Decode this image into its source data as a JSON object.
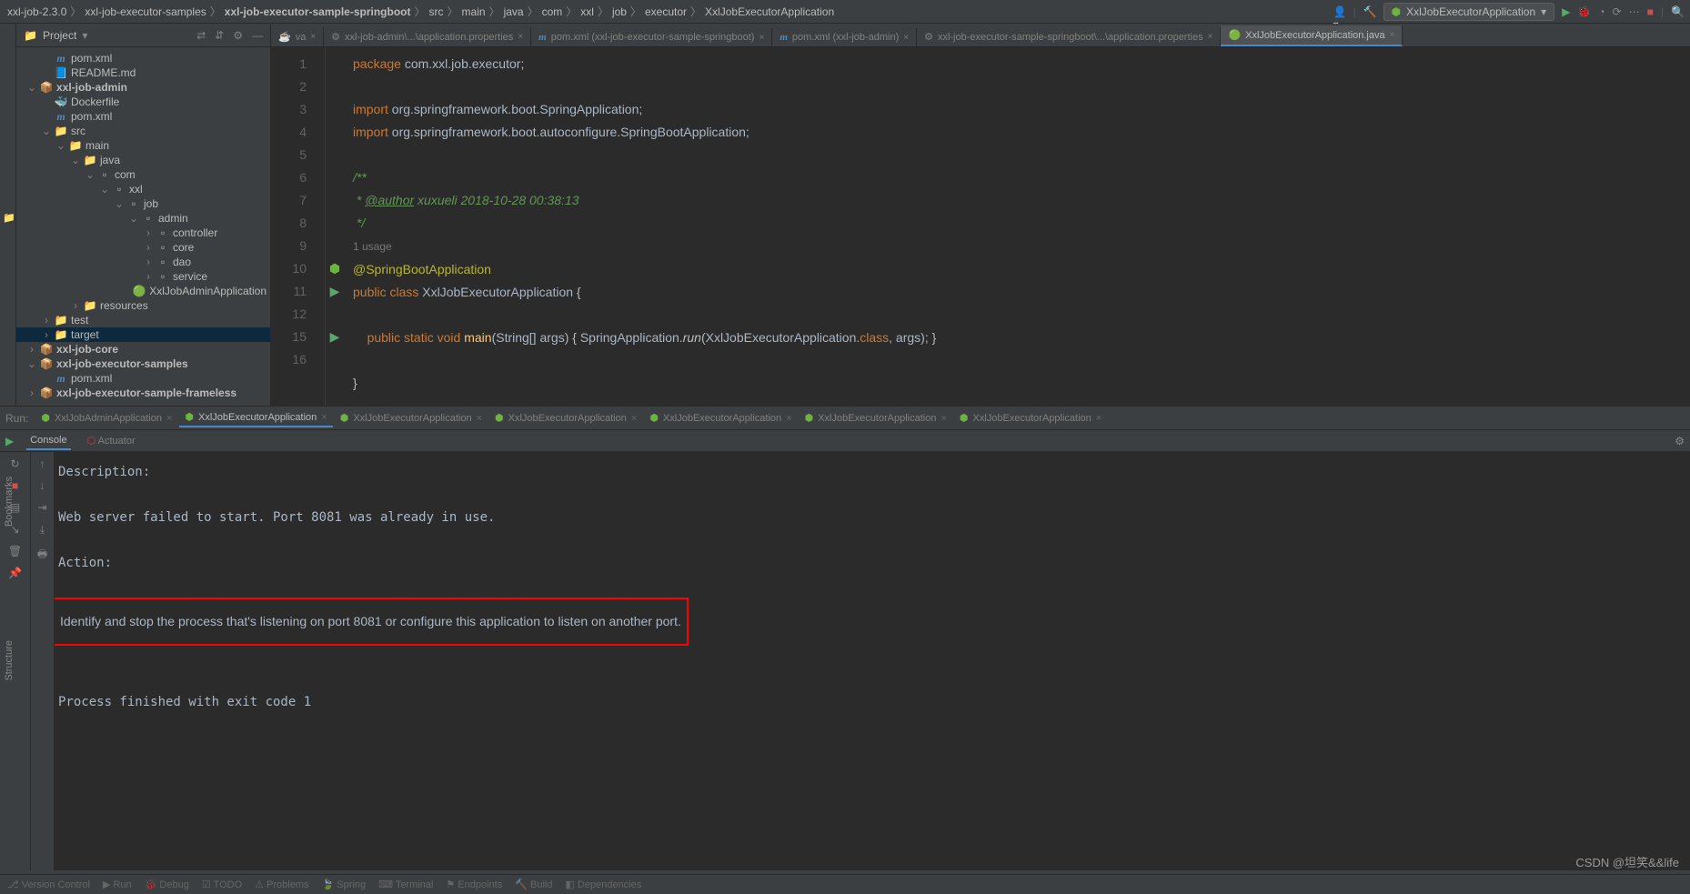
{
  "breadcrumbs": [
    "xxl-job-2.3.0",
    "xxl-job-executor-samples",
    "xxl-job-executor-sample-springboot",
    "src",
    "main",
    "java",
    "com",
    "xxl",
    "job",
    "executor",
    "XxlJobExecutorApplication"
  ],
  "breadcrumb_bold_index": 2,
  "run_config": "XxlJobExecutorApplication",
  "project": {
    "title": "Project",
    "tree": [
      {
        "depth": 1,
        "icon": "m",
        "label": "pom.xml"
      },
      {
        "depth": 1,
        "icon": "md",
        "label": "README.md"
      },
      {
        "depth": 0,
        "icon": "mod",
        "label": "xxl-job-admin",
        "twist": "v",
        "bold": true
      },
      {
        "depth": 1,
        "icon": "docker",
        "label": "Dockerfile"
      },
      {
        "depth": 1,
        "icon": "m",
        "label": "pom.xml"
      },
      {
        "depth": 1,
        "icon": "folder",
        "label": "src",
        "twist": "v"
      },
      {
        "depth": 2,
        "icon": "folder",
        "label": "main",
        "twist": "v"
      },
      {
        "depth": 3,
        "icon": "folder",
        "label": "java",
        "twist": "v"
      },
      {
        "depth": 4,
        "icon": "pkg",
        "label": "com",
        "twist": "v"
      },
      {
        "depth": 5,
        "icon": "pkg",
        "label": "xxl",
        "twist": "v"
      },
      {
        "depth": 6,
        "icon": "pkg",
        "label": "job",
        "twist": "v"
      },
      {
        "depth": 7,
        "icon": "pkg",
        "label": "admin",
        "twist": "v"
      },
      {
        "depth": 8,
        "icon": "pkg",
        "label": "controller",
        "twist": ">"
      },
      {
        "depth": 8,
        "icon": "pkg",
        "label": "core",
        "twist": ">"
      },
      {
        "depth": 8,
        "icon": "pkg",
        "label": "dao",
        "twist": ">"
      },
      {
        "depth": 8,
        "icon": "pkg",
        "label": "service",
        "twist": ">"
      },
      {
        "depth": 8,
        "icon": "class",
        "label": "XxlJobAdminApplication"
      },
      {
        "depth": 3,
        "icon": "folder",
        "label": "resources",
        "twist": ">"
      },
      {
        "depth": 1,
        "icon": "folder",
        "label": "test",
        "twist": ">"
      },
      {
        "depth": 1,
        "icon": "target",
        "label": "target",
        "twist": ">",
        "sel": true
      },
      {
        "depth": 0,
        "icon": "mod",
        "label": "xxl-job-core",
        "twist": ">",
        "bold": true
      },
      {
        "depth": 0,
        "icon": "mod",
        "label": "xxl-job-executor-samples",
        "twist": "v",
        "bold": true
      },
      {
        "depth": 1,
        "icon": "m",
        "label": "pom.xml"
      },
      {
        "depth": 0,
        "icon": "mod",
        "label": "xxl-job-executor-sample-frameless",
        "twist": ">",
        "bold": true
      }
    ]
  },
  "editor_tabs": [
    {
      "icon": "java",
      "label": "va",
      "close": true
    },
    {
      "icon": "props",
      "label": "xxl-job-admin\\...\\application.properties",
      "close": true
    },
    {
      "icon": "m",
      "label": "pom.xml (xxl-job-executor-sample-springboot)",
      "close": true
    },
    {
      "icon": "m",
      "label": "pom.xml (xxl-job-admin)",
      "close": true
    },
    {
      "icon": "props",
      "label": "xxl-job-executor-sample-springboot\\...\\application.properties",
      "close": true
    },
    {
      "icon": "class",
      "label": "XxlJobExecutorApplication.java",
      "close": true,
      "active": true
    }
  ],
  "code": {
    "lines": [
      "1",
      "2",
      "3",
      "4",
      "5",
      "6",
      "7",
      "8",
      "",
      "9",
      "10",
      "11",
      "12",
      "15",
      "16"
    ],
    "pkg": "package",
    "pkg_name": "com.xxl.job.executor",
    "imp": "import",
    "imp1": "org.springframework.boot.SpringApplication",
    "imp2": "org.springframework.boot.autoconfigure.",
    "imp2b": "SpringBootApplication",
    "doc_open": "/**",
    "doc_auth": " * @author",
    "doc_auth_txt": " xuxueli 2018-10-28 00:38:13",
    "doc_close": " */",
    "usage": "1 usage",
    "ann": "@SpringBootApplication",
    "pub": "public",
    "cls_kw": "class",
    "cls_name": "XxlJobExecutorApplication",
    "brace_o": "{",
    "stat": "static",
    "void": "void",
    "main": "main",
    "args": "(String[] args)",
    "body_o": "{",
    "call1": "SpringApplication.",
    "run": "run",
    "call2": "(XxlJobExecutorApplication.",
    "class_kw": "class",
    "call3": ", args);",
    "body_c": "}",
    "brace_c": "}"
  },
  "run": {
    "label": "Run:",
    "tabs": [
      {
        "label": "XxlJobAdminApplication"
      },
      {
        "label": "XxlJobExecutorApplication",
        "active": true
      },
      {
        "label": "XxlJobExecutorApplication"
      },
      {
        "label": "XxlJobExecutorApplication"
      },
      {
        "label": "XxlJobExecutorApplication"
      },
      {
        "label": "XxlJobExecutorApplication"
      },
      {
        "label": "XxlJobExecutorApplication"
      }
    ],
    "subtabs": [
      {
        "label": "Console",
        "active": true
      },
      {
        "label": "Actuator"
      }
    ],
    "console": [
      "Description:",
      "",
      "Web server failed to start. Port 8081 was already in use.",
      "",
      "Action:",
      "",
      "Identify and stop the process that's listening on port 8081 or configure this application to listen on another port.",
      "",
      "",
      "Process finished with exit code 1"
    ],
    "highlight_index": 6
  },
  "statusbar": [
    "Version Control",
    "Run",
    "Debug",
    "TODO",
    "Problems",
    "Spring",
    "Terminal",
    "Endpoints",
    "Build",
    "Dependencies"
  ],
  "watermark": "CSDN @坦笑&&life"
}
